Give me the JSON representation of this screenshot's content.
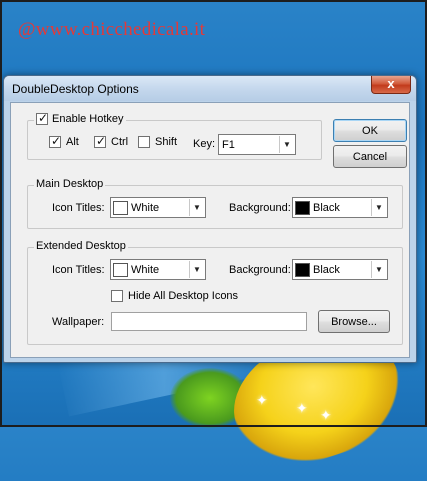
{
  "watermark": "@www.chicchedicala.it",
  "window": {
    "title": "DoubleDesktop Options",
    "close_icon": "close-x-icon",
    "close_glyph": "x"
  },
  "hotkey": {
    "enable_label": "Enable Hotkey",
    "enabled": true,
    "alt_label": "Alt",
    "alt_checked": true,
    "ctrl_label": "Ctrl",
    "ctrl_checked": true,
    "shift_label": "Shift",
    "shift_checked": false,
    "key_label": "Key:",
    "key_value": "F1"
  },
  "buttons": {
    "ok": "OK",
    "cancel": "Cancel",
    "browse": "Browse..."
  },
  "main_desktop": {
    "group_label": "Main Desktop",
    "icon_titles_label": "Icon Titles:",
    "icon_titles_value": "White",
    "icon_titles_color": "#ffffff",
    "background_label": "Background:",
    "background_value": "Black",
    "background_color": "#000000"
  },
  "extended_desktop": {
    "group_label": "Extended Desktop",
    "icon_titles_label": "Icon Titles:",
    "icon_titles_value": "White",
    "icon_titles_color": "#ffffff",
    "background_label": "Background:",
    "background_value": "Black",
    "background_color": "#000000",
    "hide_icons_label": "Hide All Desktop Icons",
    "hide_icons_checked": false,
    "wallpaper_label": "Wallpaper:",
    "wallpaper_value": ""
  },
  "colors": {
    "accent": "#3c7fb1",
    "watermark": "#e23a3a"
  }
}
